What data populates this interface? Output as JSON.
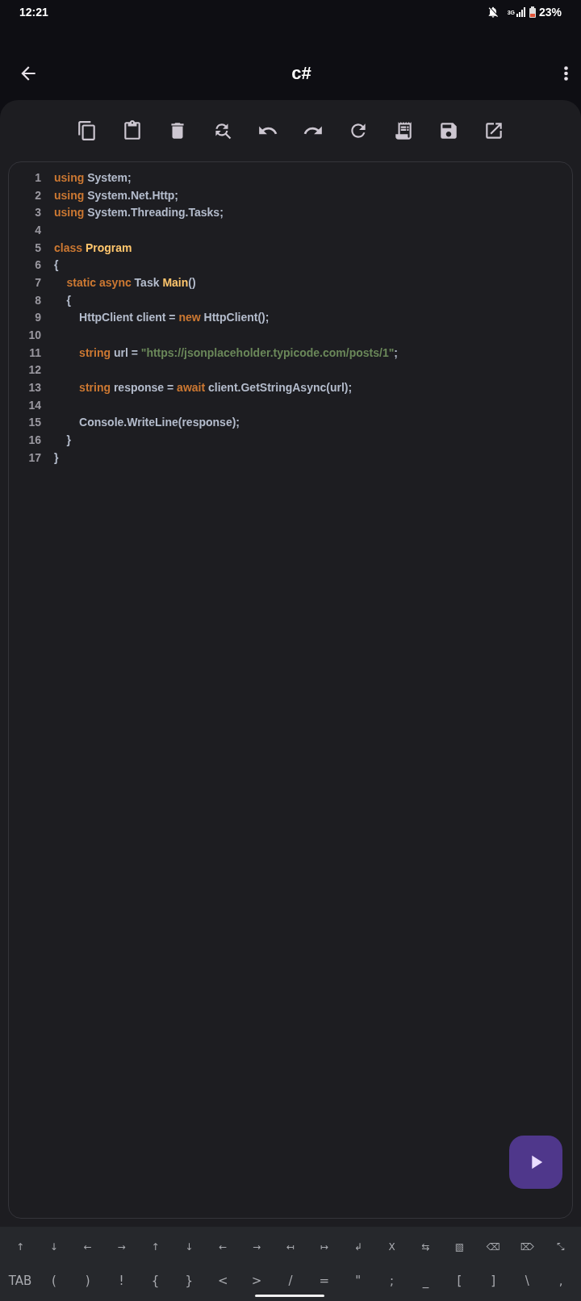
{
  "status_bar": {
    "time": "12:21",
    "network": "3G",
    "battery": "23%"
  },
  "app_bar": {
    "title": "c#"
  },
  "editor": {
    "lines": [
      {
        "number": "1",
        "tokens": [
          {
            "kind": "keyword",
            "text": "using"
          },
          {
            "kind": "plain",
            "text": " System;"
          }
        ]
      },
      {
        "number": "2",
        "tokens": [
          {
            "kind": "keyword",
            "text": "using"
          },
          {
            "kind": "plain",
            "text": " System.Net.Http;"
          }
        ]
      },
      {
        "number": "3",
        "tokens": [
          {
            "kind": "keyword",
            "text": "using"
          },
          {
            "kind": "plain",
            "text": " System.Threading.Tasks;"
          }
        ]
      },
      {
        "number": "4"
      },
      {
        "number": "5",
        "tokens": [
          {
            "kind": "keyword",
            "text": "class"
          },
          {
            "kind": "class",
            "text": " Program"
          }
        ]
      },
      {
        "number": "6",
        "tokens": [
          {
            "kind": "plain",
            "text": "{"
          }
        ]
      },
      {
        "number": "7",
        "tokens": [
          {
            "kind": "keyword",
            "text": "    static async"
          },
          {
            "kind": "plain",
            "text": " Task "
          },
          {
            "kind": "class",
            "text": "Main"
          },
          {
            "kind": "plain",
            "text": "()"
          }
        ]
      },
      {
        "number": "8",
        "tokens": [
          {
            "kind": "plain",
            "text": "    {"
          }
        ]
      },
      {
        "number": "9",
        "tokens": [
          {
            "kind": "plain",
            "text": "        HttpClient client = "
          },
          {
            "kind": "keyword",
            "text": "new"
          },
          {
            "kind": "plain",
            "text": " HttpClient();"
          }
        ]
      },
      {
        "number": "10"
      },
      {
        "number": "11",
        "tokens": [
          {
            "kind": "keyword",
            "text": "        string"
          },
          {
            "kind": "plain",
            "text": " url = "
          },
          {
            "kind": "string",
            "text": "\"https://jsonplaceholder.typicode.com/posts/1\""
          },
          {
            "kind": "plain",
            "text": ";"
          }
        ]
      },
      {
        "number": "12"
      },
      {
        "number": "13",
        "tokens": [
          {
            "kind": "keyword",
            "text": "        string"
          },
          {
            "kind": "plain",
            "text": " response = "
          },
          {
            "kind": "keyword",
            "text": "await"
          },
          {
            "kind": "plain",
            "text": " client.GetStringAsync(url);"
          }
        ]
      },
      {
        "number": "14"
      },
      {
        "number": "15",
        "tokens": [
          {
            "kind": "plain",
            "text": "        Console.WriteLine(response);"
          }
        ]
      },
      {
        "number": "16",
        "tokens": [
          {
            "kind": "plain",
            "text": "    }"
          }
        ]
      },
      {
        "number": "17",
        "tokens": [
          {
            "kind": "plain",
            "text": "}"
          }
        ]
      }
    ]
  },
  "keyboard": {
    "rows": [
      [
        "↑",
        "↓",
        "←",
        "→",
        "↑",
        "↓",
        "←",
        "→",
        "↤",
        "↦",
        "↲",
        "X",
        "⇆",
        "▧",
        "⌫",
        "⌦",
        "⤡"
      ],
      [
        "TAB",
        "(",
        ")",
        "!",
        "{",
        "}",
        "<",
        ">",
        "/",
        "=",
        "\"",
        ";",
        "_",
        "[",
        "]",
        "\\",
        ","
      ]
    ]
  }
}
